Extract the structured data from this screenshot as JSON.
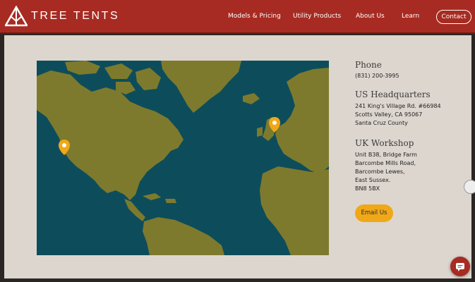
{
  "header": {
    "brand": "TREE TENTS",
    "logo_icon": "tree-tent-logo-icon",
    "nav": [
      {
        "label": "Models & Pricing"
      },
      {
        "label": "Utility Products"
      },
      {
        "label": "About Us"
      },
      {
        "label": "Learn"
      }
    ],
    "contact_label": "Contact"
  },
  "contact": {
    "phone_heading": "Phone",
    "phone": "(831) 200-3995",
    "us_heading": "US Headquarters",
    "us_lines": [
      "241 King's Village Rd. #66984",
      "Scotts Valley, CA 95067",
      "Santa Cruz County"
    ],
    "uk_heading": "UK Workshop",
    "uk_lines": [
      "Unit B38, Bridge Farm",
      "Barcombe Mills Road,",
      "Barcombe Lewes,",
      "East Sussex.",
      "BN8 5BX"
    ],
    "email_label": "Email Us"
  },
  "map": {
    "ocean_color": "#0d4d5b",
    "land_color": "#7d7a2e",
    "pin_color": "#f0a818",
    "pins": [
      "us-headquarters-pin",
      "uk-workshop-pin"
    ]
  },
  "colors": {
    "header": "#a72b22",
    "page_bg": "#ddd6cf",
    "accent": "#f0a818"
  },
  "icons": {
    "chat": "chat-bubble-icon",
    "scroll_arrow": "chevron-right-icon"
  }
}
